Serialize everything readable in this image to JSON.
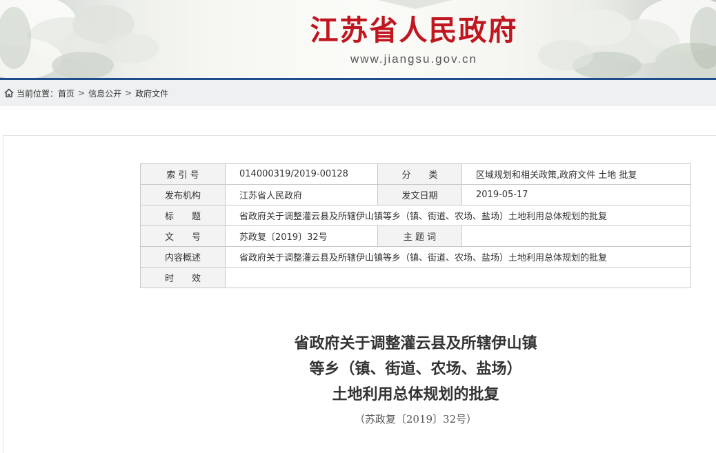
{
  "header": {
    "site_title": "江苏省人民政府",
    "site_url": "www.jiangsu.gov.cn",
    "brand_color": "#c0161f",
    "rule_color": "#1f4d8c"
  },
  "breadcrumb": {
    "icon": "home-icon",
    "label": "当前位置：",
    "items": [
      "首页",
      "信息公开",
      "政府文件"
    ],
    "separator": ">"
  },
  "info_table": {
    "rows": [
      {
        "l1": "索 引 号",
        "v1": "014000319/2019-00128",
        "l2": "分　　类",
        "v2": "区域规划和相关政策,政府文件 土地 批复"
      },
      {
        "l1": "发布机构",
        "v1": "江苏省人民政府",
        "l2": "发文日期",
        "v2": "2019-05-17"
      },
      {
        "l1": "标　　题",
        "v1": "省政府关于调整灌云县及所辖伊山镇等乡（镇、街道、农场、盐场）土地利用总体规划的批复"
      },
      {
        "l1": "文　　号",
        "v1": "苏政复〔2019〕32号",
        "l2": "主 题 词",
        "v2": ""
      },
      {
        "l1": "内容概述",
        "v1": "省政府关于调整灌云县及所辖伊山镇等乡（镇、街道、农场、盐场）土地利用总体规划的批复"
      },
      {
        "l1": "时　　效",
        "v1": ""
      }
    ]
  },
  "document": {
    "title_lines": [
      "省政府关于调整灌云县及所辖伊山镇",
      "等乡（镇、街道、农场、盐场）",
      "土地利用总体规划的批复"
    ],
    "number": "（苏政复〔2019〕32号）"
  }
}
